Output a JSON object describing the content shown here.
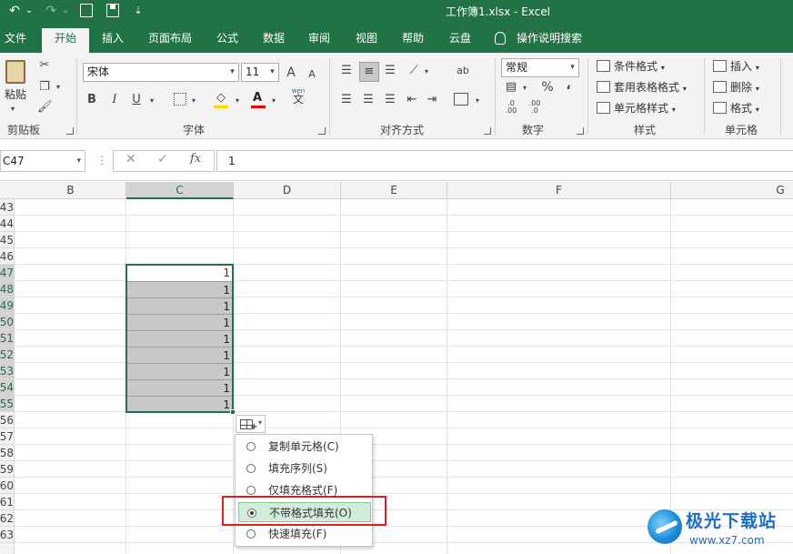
{
  "titlebar": {
    "title": "工作簿1.xlsx  -  Excel",
    "undo_icon": "↶",
    "redo_icon": "↷",
    "caret": "⌄",
    "customize": "⇣"
  },
  "tabs": [
    "文件",
    "开始",
    "插入",
    "页面布局",
    "公式",
    "数据",
    "审阅",
    "视图",
    "帮助",
    "云盘"
  ],
  "tell_me": "操作说明搜索",
  "ribbon": {
    "clipboard": {
      "paste": "粘贴",
      "label": "剪贴板"
    },
    "font": {
      "name": "宋体",
      "size": "11",
      "grow": "A",
      "shrink": "A",
      "bold": "B",
      "italic": "I",
      "underline": "U",
      "wen": "wén",
      "wen_char": "文",
      "label": "字体"
    },
    "alignment": {
      "label": "对齐方式",
      "ab": "ab"
    },
    "number": {
      "format": "常规",
      "percent": "%",
      "comma": "،",
      "label": "数字"
    },
    "styles": {
      "conditional": "条件格式",
      "table": "套用表格格式",
      "cell": "单元格样式",
      "label": "样式"
    },
    "cells": {
      "insert": "插入",
      "delete": "删除",
      "format": "格式",
      "label": "单元格"
    }
  },
  "formula_bar": {
    "name_box": "C47",
    "cancel": "✕",
    "enter": "✓",
    "fx": "fx",
    "value": "1"
  },
  "columns": [
    "B",
    "C",
    "D",
    "E",
    "F",
    "G"
  ],
  "rows": [
    "43",
    "44",
    "45",
    "46",
    "47",
    "48",
    "49",
    "50",
    "51",
    "52",
    "53",
    "54",
    "55",
    "56",
    "57",
    "58",
    "59",
    "60",
    "61",
    "62",
    "63"
  ],
  "cells": [
    "1",
    "1",
    "1",
    "1",
    "1",
    "1",
    "1",
    "1",
    "1"
  ],
  "autofill_menu": {
    "options": [
      "复制单元格(C)",
      "填充序列(S)",
      "仅填充格式(F)",
      "不带格式填充(O)",
      "快速填充(F)"
    ],
    "selected_index": 3
  },
  "watermark": {
    "line1": "极光下载站",
    "line2": "www.xz7.com"
  },
  "colors": {
    "excel_green": "#217346",
    "fill_gray": "#c8c8c8",
    "highlight_red": "#d9201b",
    "first_value_red": "#c00000"
  }
}
